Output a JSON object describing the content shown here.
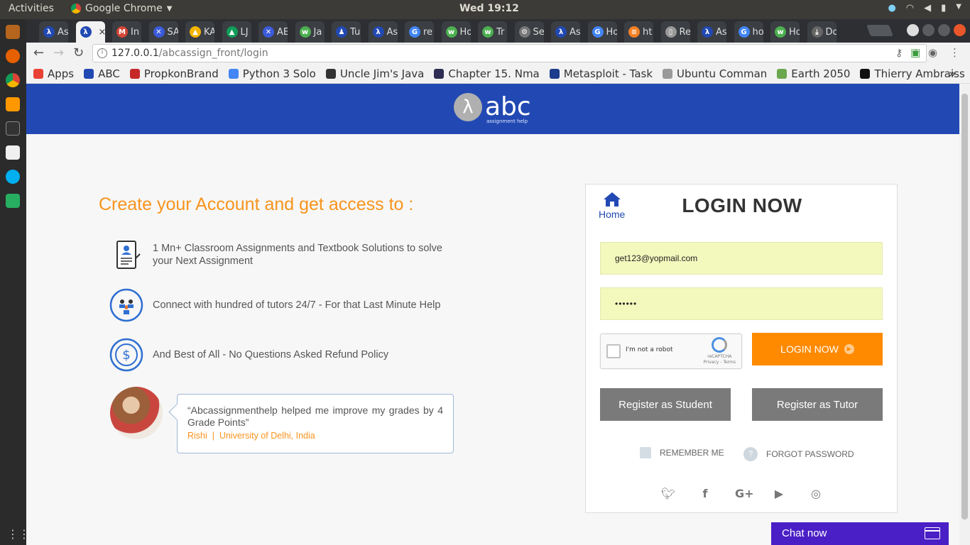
{
  "system": {
    "activities": "Activities",
    "app_name": "Google Chrome",
    "clock": "Wed 19:12"
  },
  "tabs": [
    {
      "label": "As",
      "icon": "lambda-icon",
      "color": "#2249b3",
      "glyph": "λ"
    },
    {
      "label": "",
      "icon": "lambda-icon",
      "color": "#2249b3",
      "glyph": "λ",
      "active": true
    },
    {
      "label": "In",
      "icon": "gmail-icon",
      "color": "#d44638",
      "glyph": "M"
    },
    {
      "label": "SA",
      "icon": "cross-icon",
      "color": "#3b5bdb",
      "glyph": "✕"
    },
    {
      "label": "KA",
      "icon": "drive-icon",
      "color": "#f4b400",
      "glyph": "▲"
    },
    {
      "label": "LJ",
      "icon": "drive-icon",
      "color": "#0f9d58",
      "glyph": "▲"
    },
    {
      "label": "AE",
      "icon": "cross-icon",
      "color": "#3b5bdb",
      "glyph": "✕"
    },
    {
      "label": "Ja",
      "icon": "w3-icon",
      "color": "#4caf50",
      "glyph": "w"
    },
    {
      "label": "Tu",
      "icon": "person-icon",
      "color": "#2249b3",
      "glyph": "♟"
    },
    {
      "label": "As",
      "icon": "lambda-icon",
      "color": "#2249b3",
      "glyph": "λ"
    },
    {
      "label": "re",
      "icon": "google-icon",
      "color": "#4285f4",
      "glyph": "G"
    },
    {
      "label": "Ho",
      "icon": "w3-icon",
      "color": "#4caf50",
      "glyph": "w"
    },
    {
      "label": "Tr",
      "icon": "w3-icon",
      "color": "#4caf50",
      "glyph": "w"
    },
    {
      "label": "Se",
      "icon": "gear-icon",
      "color": "#777777",
      "glyph": "⚙"
    },
    {
      "label": "As",
      "icon": "lambda-icon",
      "color": "#2249b3",
      "glyph": "λ"
    },
    {
      "label": "Ho",
      "icon": "google-icon",
      "color": "#4285f4",
      "glyph": "G"
    },
    {
      "label": "ht",
      "icon": "stackoverflow-icon",
      "color": "#f48024",
      "glyph": "≡"
    },
    {
      "label": "Re",
      "icon": "document-icon",
      "color": "#999999",
      "glyph": "▯"
    },
    {
      "label": "As",
      "icon": "lambda-icon",
      "color": "#2249b3",
      "glyph": "λ"
    },
    {
      "label": "ho",
      "icon": "google-icon",
      "color": "#4285f4",
      "glyph": "G"
    },
    {
      "label": "Ho",
      "icon": "w3-icon",
      "color": "#4caf50",
      "glyph": "w"
    },
    {
      "label": "Do",
      "icon": "download-icon",
      "color": "#666666",
      "glyph": "⤓"
    }
  ],
  "address_bar": {
    "host": "127.0.0.1",
    "path": "/abcassign_front/login"
  },
  "bookmarks": [
    {
      "label": "Apps",
      "color": "#e94235"
    },
    {
      "label": "ABC",
      "color": "#2249b3"
    },
    {
      "label": "PropkonBrand",
      "color": "#c62828"
    },
    {
      "label": "Python 3 Solo",
      "color": "#4285f4"
    },
    {
      "label": "Uncle Jim's Java",
      "color": "#333333"
    },
    {
      "label": "Chapter 15. Nma",
      "color": "#2c2c54"
    },
    {
      "label": "Metasploit - Task",
      "color": "#1e3c8c"
    },
    {
      "label": "Ubuntu Comman",
      "color": "#999999"
    },
    {
      "label": "Earth 2050",
      "color": "#6aa84f"
    },
    {
      "label": "Thierry Ambraiss",
      "color": "#111111"
    }
  ],
  "page": {
    "logo": {
      "word": "abc",
      "tagline": "assignment help",
      "glyph": "λ"
    },
    "headline": "Create your Account and get access to :",
    "features": [
      {
        "text": "1 Mn+ Classroom Assignments and Textbook Solutions to solve your Next Assignment",
        "icon": "document-user-icon"
      },
      {
        "text": "Connect with hundred of tutors 24/7 - For that Last Minute Help",
        "icon": "tutors-cycle-icon"
      },
      {
        "text": "And Best of All - No Questions Asked Refund Policy",
        "icon": "dollar-refund-icon"
      }
    ],
    "testimonial": {
      "quote": "“Abcassignmenthelp helped me improve my grades by 4 Grade Points”",
      "author": "Rishi",
      "separator": "|",
      "university": "University of Delhi, India"
    },
    "login": {
      "home_label": "Home",
      "title": "LOGIN NOW",
      "email_value": "get123@yopmail.com",
      "password_value": "••••••",
      "captcha_label": "I'm not a robot",
      "captcha_brand": "reCAPTCHA",
      "captcha_links": "Privacy - Terms",
      "login_button": "LOGIN NOW",
      "register_student": "Register as Student",
      "register_tutor": "Register as Tutor",
      "remember_me": "REMEMBER ME",
      "forgot_password": "FORGOT PASSWORD",
      "socials": [
        "twitter-icon",
        "facebook-icon",
        "google-plus-icon",
        "youtube-icon",
        "instagram-icon"
      ]
    },
    "chat_label": "Chat now"
  },
  "colors": {
    "brand_blue": "#2249b3",
    "accent_orange": "#ff8a00",
    "headline_orange": "#f7941d",
    "input_bg": "#f3f8bd",
    "grey_button": "#7a7a7a",
    "chat_purple": "#4a1fc6"
  }
}
